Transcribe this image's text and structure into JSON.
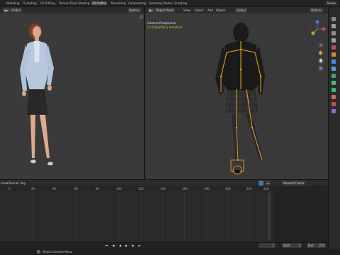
{
  "workspaces": [
    "Modeling",
    "Sculpting",
    "UV Editing",
    "Texture Paint",
    "Shading",
    "Animation",
    "Rendering",
    "Compositing",
    "Geometry Nodes",
    "Scripting"
  ],
  "active_workspace": "Animation",
  "scene": "Scene",
  "left_viewport": {
    "orientation": "Global",
    "options": "Options"
  },
  "right_viewport": {
    "mode": "Object Mode",
    "menus": [
      "View",
      "Select",
      "Add",
      "Object"
    ],
    "orientation": "Global",
    "options": "Options",
    "camera_label": "Camera Perspective",
    "collection_label": "(1) Collection | Armature"
  },
  "timeline": {
    "menus": [
      "View",
      "Channel",
      "Key"
    ],
    "ticks": [
      "0",
      "20",
      "40",
      "60",
      "80",
      "100",
      "120",
      "140",
      "160",
      "180",
      "200",
      "220",
      "240"
    ],
    "interpolation": "Nearest Frame",
    "current_frame": "1",
    "start_label": "Start",
    "start": "1",
    "end_label": "End",
    "end": "250"
  },
  "status": {
    "hint": "Object Context Menu"
  },
  "colors": {
    "accent": "#e6c62b",
    "armature": "#f2a51f",
    "active_tab": "#3d3d3d"
  }
}
